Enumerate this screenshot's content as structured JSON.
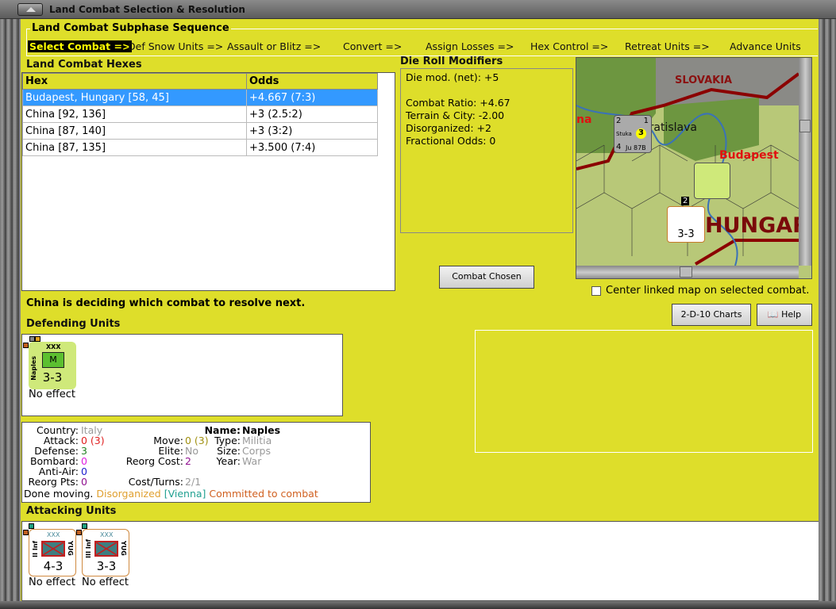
{
  "window": {
    "title": "Land Combat Selection & Resolution"
  },
  "sequence": {
    "title": "Land Combat Subphase Sequence",
    "steps": [
      "Select Combat =>",
      "Def Snow Units =>",
      "Assault or Blitz =>",
      "Convert =>",
      "Assign Losses =>",
      "Hex Control =>",
      "Retreat Units =>",
      "Advance Units"
    ]
  },
  "hexes": {
    "title": "Land Combat Hexes",
    "columns": [
      "Hex",
      "Odds"
    ],
    "rows": [
      [
        "Budapest, Hungary [58, 45]",
        "+4.667 (7:3)"
      ],
      [
        "China [92, 136]",
        "+3 (2.5:2)"
      ],
      [
        "China [87, 140]",
        "+3 (3:2)"
      ],
      [
        "China [87, 135]",
        "+3.500 (7:4)"
      ]
    ]
  },
  "modifiers": {
    "title": "Die Roll Modifiers",
    "lines": [
      "Die mod. (net): +5",
      "",
      "Combat Ratio: +4.67",
      "Terrain & City: -2.00",
      "Disorganized: +2",
      "Fractional Odds: 0"
    ]
  },
  "buttons": {
    "combat_chosen": "Combat Chosen",
    "charts": "2-D-10 Charts",
    "help": "Help"
  },
  "map": {
    "labels": [
      "SLOVAKIA",
      "Bratislava",
      "Budapest",
      "HUNGAR",
      "na"
    ],
    "stuka": {
      "name": "Stuka",
      "model": "Ju 87B",
      "tl": "2",
      "tr": "1",
      "bl": "4",
      "badge": "3"
    },
    "stack_count": "2"
  },
  "center_checkbox": {
    "label": "Center linked map on selected combat.",
    "checked": false
  },
  "status": "China is deciding which combat to resolve next.",
  "defending": {
    "title": "Defending Units",
    "units": [
      {
        "side": "Naples",
        "size": "XXX",
        "type": "M",
        "strength": "3-3",
        "result": "No effect"
      }
    ]
  },
  "info": {
    "country": [
      "Country:",
      "Italy"
    ],
    "attack": [
      "Attack:",
      "0 (3)"
    ],
    "defense": [
      "Defense:",
      "3"
    ],
    "bombard": [
      "Bombard:",
      "0"
    ],
    "antiair": [
      "Anti-Air:",
      "0"
    ],
    "reorgpts": [
      "Reorg Pts:",
      "0"
    ],
    "name": [
      "Name:",
      "Naples"
    ],
    "move": [
      "Move:",
      "0 (3)"
    ],
    "elite": [
      "Elite:",
      "No"
    ],
    "reorgcost": [
      "Reorg Cost:",
      "2"
    ],
    "costturns": [
      "Cost/Turns:",
      "2/1"
    ],
    "type": [
      "Type:",
      "Militia"
    ],
    "size": [
      "Size:",
      "Corps"
    ],
    "year": [
      "Year:",
      "War"
    ],
    "status": [
      "Done moving.",
      "Disorganized",
      "[Vienna]",
      "Committed to combat"
    ]
  },
  "attacking": {
    "title": "Attacking Units",
    "units": [
      {
        "side": "II Inf",
        "nation": "YUG",
        "size": "XXX",
        "strength": "4-3",
        "result": "No effect"
      },
      {
        "side": "III Inf",
        "nation": "YUG",
        "size": "XXX",
        "strength": "3-3",
        "result": "No effect"
      }
    ]
  },
  "colors": {
    "panel": "#dede2a",
    "select": "#3399ff"
  }
}
